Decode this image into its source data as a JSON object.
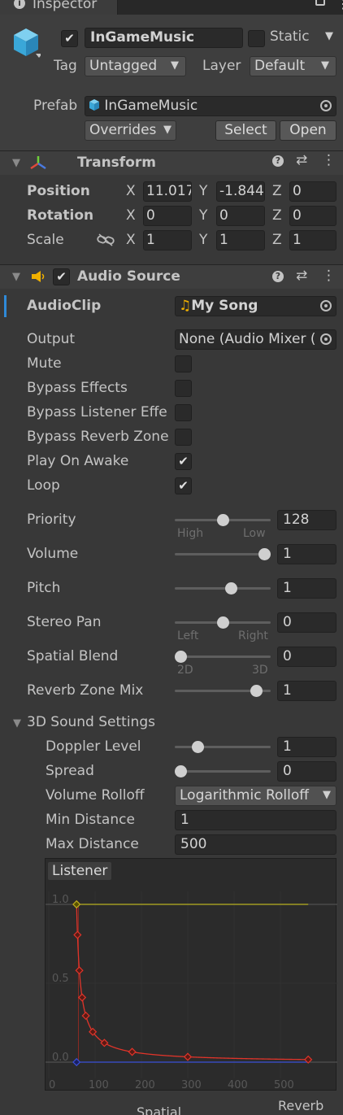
{
  "tab": {
    "title": "Inspector"
  },
  "gameobject": {
    "active": true,
    "name": "InGameMusic",
    "static_label": "Static",
    "tag_label": "Tag",
    "tag_value": "Untagged",
    "layer_label": "Layer",
    "layer_value": "Default",
    "prefab_label": "Prefab",
    "prefab_value": "InGameMusic",
    "overrides_label": "Overrides",
    "select_label": "Select",
    "open_label": "Open"
  },
  "transform": {
    "title": "Transform",
    "position_label": "Position",
    "rotation_label": "Rotation",
    "scale_label": "Scale",
    "position": {
      "x": "11.017",
      "y": "-1.844",
      "z": "0"
    },
    "rotation": {
      "x": "0",
      "y": "0",
      "z": "0"
    },
    "scale": {
      "x": "1",
      "y": "1",
      "z": "1"
    },
    "axis_x": "X",
    "axis_y": "Y",
    "axis_z": "Z"
  },
  "audio": {
    "title": "Audio Source",
    "enabled": true,
    "audioclip_label": "AudioClip",
    "audioclip_value": "My Song",
    "output_label": "Output",
    "output_value": "None (Audio Mixer (",
    "mute_label": "Mute",
    "bypass_effects_label": "Bypass Effects",
    "bypass_listener_label": "Bypass Listener Effe",
    "bypass_reverb_label": "Bypass Reverb Zone",
    "play_on_awake_label": "Play On Awake",
    "loop_label": "Loop",
    "mute": false,
    "bypass_effects": false,
    "bypass_listener": false,
    "bypass_reverb": false,
    "play_on_awake": true,
    "loop": true,
    "priority_label": "Priority",
    "priority_value": "128",
    "priority_min": "High",
    "priority_max": "Low",
    "priority_fraction": 0.5,
    "volume_label": "Volume",
    "volume_value": "1",
    "volume_fraction": 1.0,
    "pitch_label": "Pitch",
    "pitch_value": "1",
    "pitch_fraction": 0.6,
    "stereo_label": "Stereo Pan",
    "stereo_value": "0",
    "stereo_min": "Left",
    "stereo_max": "Right",
    "stereo_fraction": 0.5,
    "spatial_label": "Spatial Blend",
    "spatial_value": "0",
    "spatial_min": "2D",
    "spatial_max": "3D",
    "spatial_fraction": 0.0,
    "reverb_label": "Reverb Zone Mix",
    "reverb_value": "1",
    "reverb_fraction": 0.9
  },
  "sound3d": {
    "title": "3D Sound Settings",
    "doppler_label": "Doppler Level",
    "doppler_value": "1",
    "doppler_fraction": 0.2,
    "spread_label": "Spread",
    "spread_value": "0",
    "spread_fraction": 0.0,
    "rolloff_label": "Volume Rolloff",
    "rolloff_value": "Logarithmic Rolloff",
    "min_label": "Min Distance",
    "min_value": "1",
    "max_label": "Max Distance",
    "max_value": "500"
  },
  "graph": {
    "listener_label": "Listener",
    "y_ticks": [
      "1.0",
      "0.5",
      "0.0"
    ],
    "x_ticks": [
      "0",
      "100",
      "200",
      "300",
      "400",
      "500"
    ],
    "bottom_labels": [
      "Spatial",
      "Reverb"
    ],
    "colors": {
      "volume": "#e0342a",
      "spread": "#3a4fd8",
      "spatial": "#b8b020"
    }
  }
}
